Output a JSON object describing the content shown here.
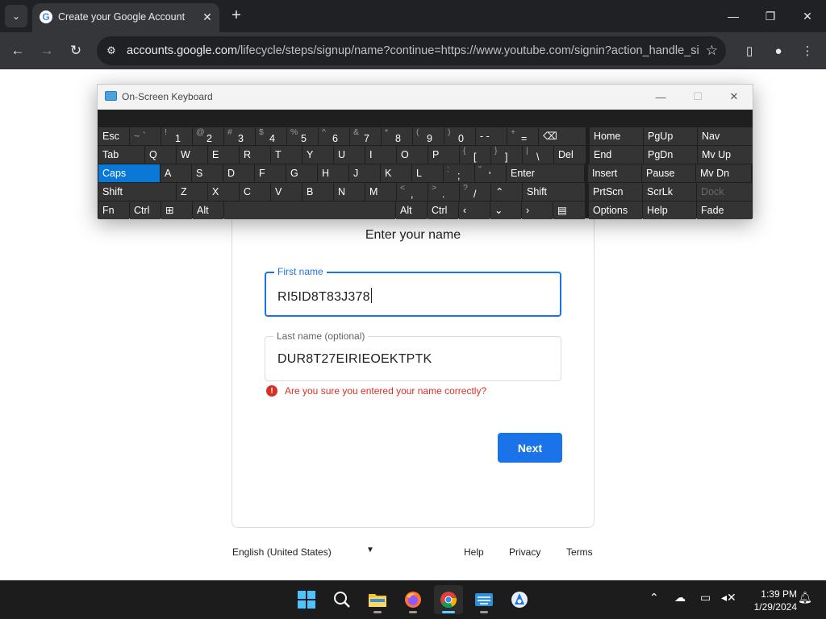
{
  "browser": {
    "tab_title": "Create your Google Account",
    "url_host": "accounts.google.com",
    "url_rest": "/lifecycle/steps/signup/name?continue=https://www.youtube.com/signin?action_handle_sig...",
    "favicon_letter": "G"
  },
  "page": {
    "subtitle": "Enter your name",
    "first_name_label": "First name",
    "first_name_value": "RI5ID8T83J378",
    "last_name_label": "Last name (optional)",
    "last_name_value": "DUR8T27EIRIEOEKTPTK",
    "error_icon": "!",
    "error_text": "Are you sure you entered your name correctly?",
    "next_label": "Next"
  },
  "footer": {
    "language": "English (United States)",
    "help": "Help",
    "privacy": "Privacy",
    "terms": "Terms"
  },
  "osk": {
    "title": "On-Screen Keyboard",
    "rows": [
      [
        {
          "label": "Esc",
          "w": 38
        },
        {
          "label": "~ `",
          "w": 38,
          "dim": true
        },
        {
          "shift": "!",
          "main": "1",
          "w": 38
        },
        {
          "shift": "@",
          "main": "2",
          "w": 38
        },
        {
          "shift": "#",
          "main": "3",
          "w": 38
        },
        {
          "shift": "$",
          "main": "4",
          "w": 38
        },
        {
          "shift": "%",
          "main": "5",
          "w": 38
        },
        {
          "shift": "^",
          "main": "6",
          "w": 38
        },
        {
          "shift": "&",
          "main": "7",
          "w": 38
        },
        {
          "shift": "*",
          "main": "8",
          "w": 38
        },
        {
          "shift": "(",
          "main": "9",
          "w": 38
        },
        {
          "shift": ")",
          "main": "0",
          "w": 38
        },
        {
          "label": "-  -",
          "w": 38
        },
        {
          "shift": "+",
          "main": "=",
          "w": 38
        },
        {
          "label": "⌫",
          "w": 58
        },
        {
          "gap": 4
        },
        {
          "label": "Home",
          "w": 66
        },
        {
          "label": "PgUp",
          "w": 66
        },
        {
          "label": "Nav",
          "w": 68
        }
      ],
      [
        {
          "label": "Tab",
          "w": 57
        },
        {
          "label": "Q",
          "w": 38
        },
        {
          "label": "W",
          "w": 38
        },
        {
          "label": "E",
          "w": 38
        },
        {
          "label": "R",
          "w": 38
        },
        {
          "label": "T",
          "w": 38
        },
        {
          "label": "Y",
          "w": 38
        },
        {
          "label": "U",
          "w": 38
        },
        {
          "label": "I",
          "w": 38
        },
        {
          "label": "O",
          "w": 38
        },
        {
          "label": "P",
          "w": 38
        },
        {
          "shift": "{",
          "main": "[",
          "w": 38
        },
        {
          "shift": "}",
          "main": "]",
          "w": 38
        },
        {
          "shift": "|",
          "main": "\\",
          "w": 38
        },
        {
          "label": "Del",
          "w": 39
        },
        {
          "gap": 4
        },
        {
          "label": "End",
          "w": 66
        },
        {
          "label": "PgDn",
          "w": 66
        },
        {
          "label": "Mv Up",
          "w": 68
        }
      ],
      [
        {
          "label": "Caps",
          "w": 76,
          "active": true
        },
        {
          "label": "A",
          "w": 38
        },
        {
          "label": "S",
          "w": 38
        },
        {
          "label": "D",
          "w": 38
        },
        {
          "label": "F",
          "w": 38
        },
        {
          "label": "G",
          "w": 38
        },
        {
          "label": "H",
          "w": 38
        },
        {
          "label": "J",
          "w": 38
        },
        {
          "label": "K",
          "w": 38
        },
        {
          "label": "L",
          "w": 38
        },
        {
          "shift": ":",
          "main": ";",
          "w": 38
        },
        {
          "shift": "\"",
          "main": "'",
          "w": 38
        },
        {
          "label": "Enter",
          "w": 96
        },
        {
          "gap": 4
        },
        {
          "label": "Insert",
          "w": 66
        },
        {
          "label": "Pause",
          "w": 66
        },
        {
          "label": "Mv Dn",
          "w": 68
        }
      ],
      [
        {
          "label": "Shift",
          "w": 96
        },
        {
          "label": "Z",
          "w": 38
        },
        {
          "label": "X",
          "w": 38
        },
        {
          "label": "C",
          "w": 38
        },
        {
          "label": "V",
          "w": 38
        },
        {
          "label": "B",
          "w": 38
        },
        {
          "label": "N",
          "w": 38
        },
        {
          "label": "M",
          "w": 38
        },
        {
          "shift": "<",
          "main": ",",
          "w": 38
        },
        {
          "shift": ">",
          "main": ".",
          "w": 38
        },
        {
          "shift": "?",
          "main": "/",
          "w": 38
        },
        {
          "label": "⌃",
          "w": 38
        },
        {
          "label": "Shift",
          "w": 77
        },
        {
          "gap": 4
        },
        {
          "label": "PrtScn",
          "w": 66
        },
        {
          "label": "ScrLk",
          "w": 66
        },
        {
          "label": "Dock",
          "w": 68,
          "disabled": true
        }
      ],
      [
        {
          "label": "Fn",
          "w": 38
        },
        {
          "label": "Ctrl",
          "w": 38
        },
        {
          "label": "⊞",
          "w": 38
        },
        {
          "label": "Alt",
          "w": 38
        },
        {
          "label": "",
          "w": 212
        },
        {
          "label": "Alt",
          "w": 38
        },
        {
          "label": "Ctrl",
          "w": 38
        },
        {
          "label": "‹",
          "w": 38
        },
        {
          "label": "⌄",
          "w": 38
        },
        {
          "label": "›",
          "w": 38
        },
        {
          "label": "▤",
          "w": 39
        },
        {
          "gap": 4
        },
        {
          "label": "Options",
          "w": 66
        },
        {
          "label": "Help",
          "w": 66
        },
        {
          "label": "Fade",
          "w": 68
        }
      ]
    ]
  },
  "taskbar": {
    "time": "1:39 PM",
    "date": "1/29/2024"
  }
}
